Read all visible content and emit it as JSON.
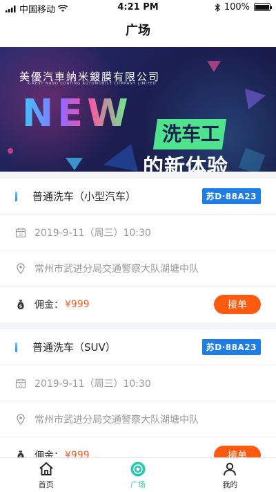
{
  "status_bar": {
    "carrier": "中国移动",
    "time": "4:21 PM",
    "battery": "100%"
  },
  "nav": {
    "title": "广场"
  },
  "banner": {
    "company_cn": "美優汽車納米鍍膜有限公司",
    "company_en": "K-REST NANO COATING AUTOMOBILE COMPANY LIMITED",
    "big": "NEW",
    "tag": "洗车工",
    "sub": "的新体验"
  },
  "orders": [
    {
      "title": "普通洗车（小型汽车）",
      "plate": "苏D·88A23",
      "datetime": "2019-9-11（周三）10:30",
      "address": "常州市武进分局交通警察大队湖塘中队",
      "commission_label": "佣金：",
      "commission": "¥999",
      "button": "接单"
    },
    {
      "title": "普通洗车（SUV）",
      "plate": "苏D·88A23",
      "datetime": "2019-9-11（周三）10:30",
      "address": "常州市武进分局交通警察大队湖塘中队",
      "commission_label": "佣金：",
      "commission": "¥999",
      "button": "接单"
    }
  ],
  "tabs": [
    {
      "label": "首页",
      "icon": "home-icon"
    },
    {
      "label": "广场",
      "icon": "plaza-icon",
      "active": true
    },
    {
      "label": "我的",
      "icon": "user-icon"
    }
  ],
  "colors": {
    "accent": "#27c9b5",
    "price": "#ff5a1f",
    "button": "#ff5a12",
    "plate": "#1e7de6"
  }
}
